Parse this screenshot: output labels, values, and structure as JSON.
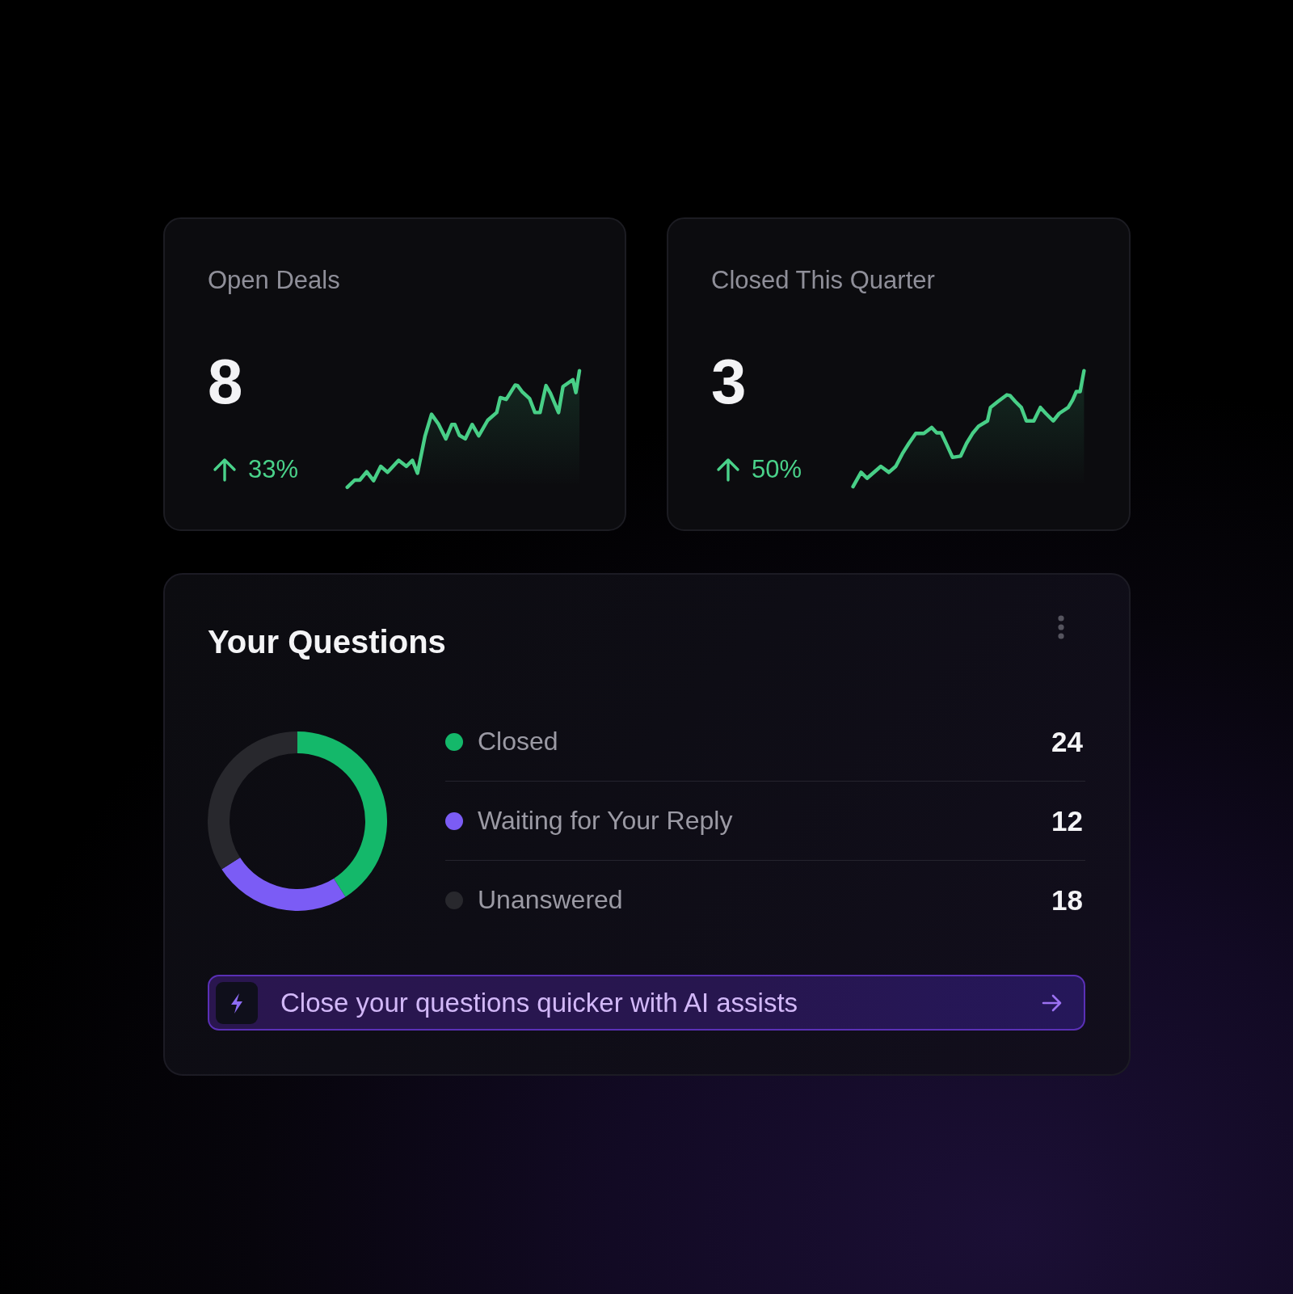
{
  "stats": [
    {
      "label": "Open Deals",
      "value": "8",
      "change": "33%"
    },
    {
      "label": "Closed This Quarter",
      "value": "3",
      "change": "50%"
    }
  ],
  "questions": {
    "title": "Your Questions",
    "statuses": [
      {
        "label": "Closed",
        "count": "24",
        "color": "#14b86a"
      },
      {
        "label": "Waiting for Your Reply",
        "count": "12",
        "color": "#7b5cf5"
      },
      {
        "label": "Unanswered",
        "count": "18",
        "color": "#28282d"
      }
    ],
    "chart_data": {
      "type": "donut",
      "values": [
        41,
        25,
        34
      ]
    },
    "cta": {
      "label": "Close your questions quicker with AI assists"
    }
  }
}
